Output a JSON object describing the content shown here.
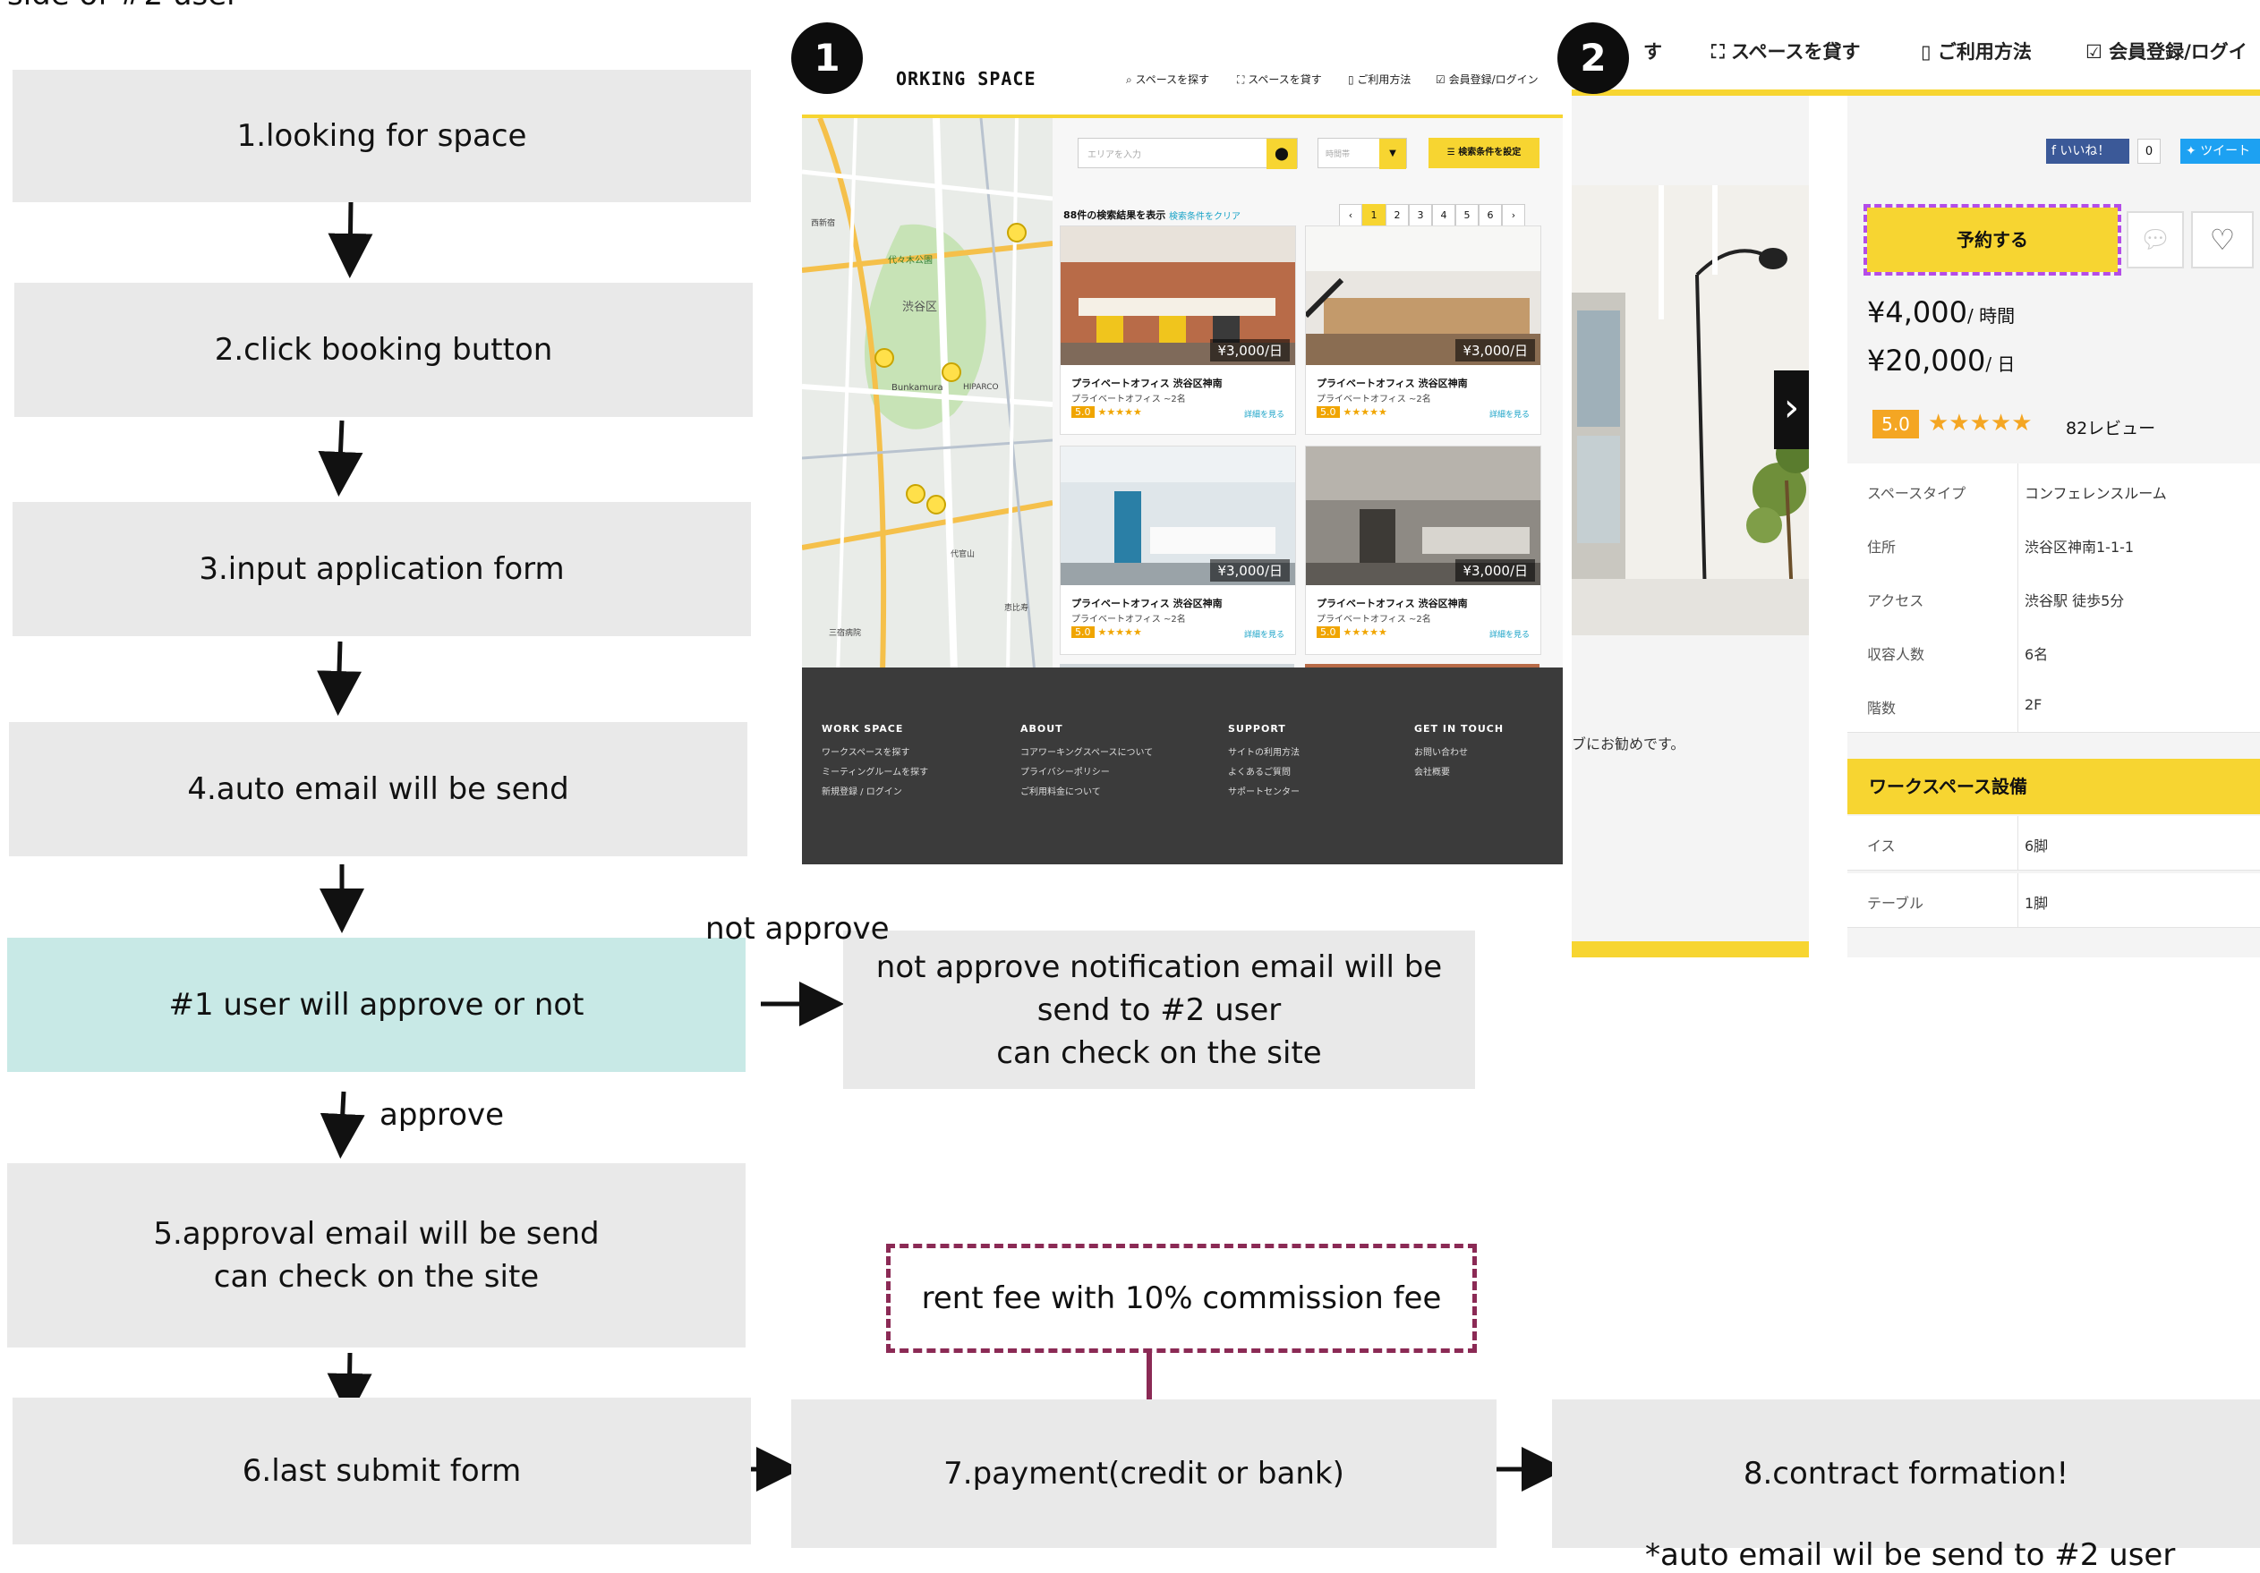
{
  "top_partial_text": "side of #2 user",
  "steps": {
    "s1": "1.looking for space",
    "s2": "2.click booking button",
    "s3": "3.input application form",
    "s4": "4.auto email will be send",
    "s_decision": "#1 user will approve or not",
    "s_notapprove": "not approve notification email will be\nsend to #2 user\ncan check on the site",
    "s5": "5.approval email will be send\ncan check on the site",
    "s6": "6.last submit form",
    "s7": "7.payment(credit or bank)",
    "s8": "8.contract formation!"
  },
  "labels": {
    "not_approve": "not approve",
    "approve": "approve",
    "commission": "rent fee with 10% commission fee",
    "auto_email_note": "*auto email wil be send to #2 user"
  },
  "colors": {
    "step_bg": "#e9e9e9",
    "decision_bg": "#c8e9e6",
    "dashed_border": "#8b2a55",
    "brand_yellow": "#f7d531",
    "footer_bg": "#3b3b3b"
  },
  "badges": {
    "one": "1",
    "two": "2"
  },
  "screenshot1": {
    "brand": "ORKING SPACE",
    "nav": [
      "スペースを探す",
      "スペースを貸す",
      "ご利用方法",
      "会員登録/ログイン"
    ],
    "search_placeholder": "エリアを入力",
    "time_placeholder": "時間帯",
    "filter_button": "検索条件を設定",
    "result_count": "88件の検索結果を表示",
    "clear_filter": "検索条件をクリア",
    "pages": [
      "1",
      "2",
      "3",
      "4",
      "5",
      "6"
    ],
    "map_labels": [
      "渋谷区",
      "Bunkamura",
      "代々木公園",
      "HIPARCO",
      "西新宿",
      "三宿病院",
      "恵比寿",
      "代官山"
    ],
    "cards": [
      {
        "title": "プライベートオフィス 渋谷区神南",
        "sub": "プライベートオフィス ~2名",
        "price": "¥3,000/日",
        "rating": "5.0",
        "detail": "詳細を見る"
      },
      {
        "title": "プライベートオフィス 渋谷区神南",
        "sub": "プライベートオフィス ~2名",
        "price": "¥3,000/日",
        "rating": "5.0",
        "detail": "詳細を見る"
      },
      {
        "title": "プライベートオフィス 渋谷区神南",
        "sub": "プライベートオフィス ~2名",
        "price": "¥3,000/日",
        "rating": "5.0",
        "detail": "詳細を見る"
      },
      {
        "title": "プライベートオフィス 渋谷区神南",
        "sub": "プライベートオフィス ~2名",
        "price": "¥3,000/日",
        "rating": "5.0",
        "detail": "詳細を見る"
      }
    ],
    "footer": {
      "col1": {
        "head": "WORK SPACE",
        "items": [
          "ワークスペースを探す",
          "ミーティングルームを探す",
          "新規登録 / ログイン"
        ]
      },
      "col2": {
        "head": "ABOUT",
        "items": [
          "コアワーキングスペースについて",
          "プライバシーポリシー",
          "ご利用料金について"
        ]
      },
      "col3": {
        "head": "SUPPORT",
        "items": [
          "サイトの利用方法",
          "よくあるご質問",
          "サポートセンター"
        ]
      },
      "col4": {
        "head": "GET IN TOUCH",
        "items": [
          "お問い合わせ",
          "会社概要"
        ]
      }
    }
  },
  "screenshot2": {
    "nav": [
      "す",
      "スペースを貸す",
      "ご利用方法",
      "会員登録/ログイ"
    ],
    "like_button": "いいね！",
    "like_count": "0",
    "tweet_button": "ツイート",
    "reserve_button": "予約する",
    "price_hour": "¥4,000",
    "price_hour_unit": "/ 時間",
    "price_day": "¥20,000",
    "price_day_unit": "/ 日",
    "rating": "5.0",
    "stars": "★★★★★",
    "reviews": "82レビュー",
    "details": [
      {
        "k": "スペースタイプ",
        "v": "コンフェレンスルーム"
      },
      {
        "k": "住所",
        "v": "渋谷区神南1-1-1"
      },
      {
        "k": "アクセス",
        "v": "渋谷駅 徒歩5分"
      },
      {
        "k": "収容人数",
        "v": "6名"
      },
      {
        "k": "階数",
        "v": "2F"
      }
    ],
    "description_fragment": "ブにお勧めです。",
    "facilities_header": "ワークスペース設備",
    "facilities": [
      {
        "k": "イス",
        "v": "6脚"
      },
      {
        "k": "テーブル",
        "v": "1脚"
      }
    ]
  }
}
